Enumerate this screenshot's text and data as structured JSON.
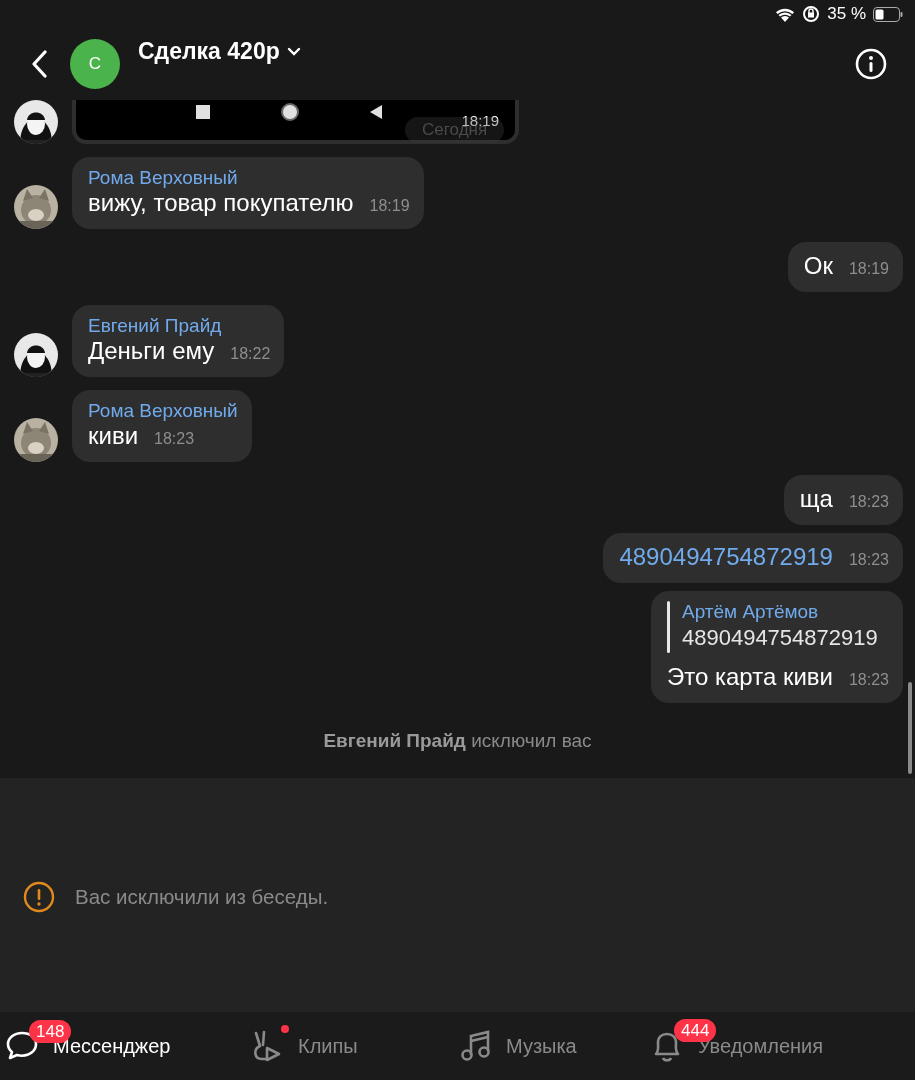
{
  "status_bar": {
    "battery": "35 %"
  },
  "header": {
    "avatar_letter": "С",
    "title": "Сделка 420р"
  },
  "date_pill": "Сегодня",
  "messages": [
    {
      "time": "18:19"
    },
    {
      "kind": "incoming",
      "author": "Рома Верховный",
      "text": "вижу, товар покупателю",
      "time": "18:19"
    },
    {
      "kind": "outgoing",
      "text": "Ок",
      "time": "18:19"
    },
    {
      "kind": "incoming",
      "author": "Евгений Прайд",
      "text": "Деньги ему",
      "time": "18:22"
    },
    {
      "kind": "incoming",
      "author": "Рома Верховный",
      "text": "киви",
      "time": "18:23"
    },
    {
      "kind": "outgoing",
      "text": "ща",
      "time": "18:23"
    },
    {
      "kind": "outgoing",
      "text": "4890494754872919",
      "time": "18:23",
      "link": true
    },
    {
      "kind": "outgoing",
      "reply": {
        "author": "Артём Артёмов",
        "text": "4890494754872919"
      },
      "text": "Это карта киви",
      "time": "18:23"
    },
    {
      "kind": "system",
      "text": "**Евгений Прайд** исключил вас"
    }
  ],
  "notice": "Вас исключили из беседы.",
  "nav": [
    {
      "kind": "chat",
      "label": "Мессенджер",
      "selected": true,
      "badge": "148"
    },
    {
      "kind": "clips",
      "label": "Клипы",
      "selected": false,
      "dot": true
    },
    {
      "kind": "music",
      "label": "Музыка",
      "selected": false
    },
    {
      "kind": "bell",
      "label": "Уведомления",
      "selected": false,
      "badge": "444"
    }
  ]
}
